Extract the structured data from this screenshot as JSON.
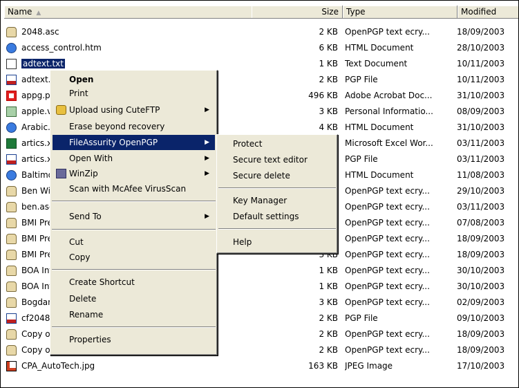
{
  "columns": {
    "name": "Name",
    "size": "Size",
    "type": "Type",
    "modified": "Modified"
  },
  "files": [
    {
      "icon": "asc",
      "name": "2048.asc",
      "size": "2 KB",
      "type": "OpenPGP text ecry...",
      "modified": "18/09/2003"
    },
    {
      "icon": "htm",
      "name": "access_control.htm",
      "size": "6 KB",
      "type": "HTML Document",
      "modified": "28/10/2003"
    },
    {
      "icon": "txt",
      "name": "adtext.txt",
      "size": "1 KB",
      "type": "Text Document",
      "modified": "10/11/2003",
      "selected": true
    },
    {
      "icon": "pgp",
      "name": "adtext.txt.pgp",
      "size": "2 KB",
      "type": "PGP File",
      "modified": "10/11/2003"
    },
    {
      "icon": "pdf",
      "name": "appg.pdf",
      "size": "496 KB",
      "type": "Adobe Acrobat Doc...",
      "modified": "31/10/2003"
    },
    {
      "icon": "vcf",
      "name": "apple.vcf",
      "size": "3 KB",
      "type": "Personal Informatio...",
      "modified": "08/09/2003"
    },
    {
      "icon": "htm",
      "name": "Arabic.htm",
      "size": "4 KB",
      "type": "HTML Document",
      "modified": "31/10/2003"
    },
    {
      "icon": "xls",
      "name": "artics.xls",
      "size": "",
      "type": "Microsoft Excel Wor...",
      "modified": "03/11/2003"
    },
    {
      "icon": "pgp",
      "name": "artics.xls.pgp",
      "size": "",
      "type": "PGP File",
      "modified": "03/11/2003"
    },
    {
      "icon": "htm",
      "name": "Baltimore.htm",
      "size": "",
      "type": "HTML Document",
      "modified": "11/08/2003"
    },
    {
      "icon": "asc",
      "name": "Ben Wilson.asc",
      "size": "",
      "type": "OpenPGP text ecry...",
      "modified": "29/10/2003"
    },
    {
      "icon": "asc",
      "name": "ben.asc",
      "size": "",
      "type": "OpenPGP text ecry...",
      "modified": "03/11/2003"
    },
    {
      "icon": "asc",
      "name": "BMI President_1.asc",
      "size": "",
      "type": "OpenPGP text ecry...",
      "modified": "07/08/2003"
    },
    {
      "icon": "asc",
      "name": "BMI President_2.asc",
      "size": "",
      "type": "OpenPGP text ecry...",
      "modified": "18/09/2003"
    },
    {
      "icon": "asc",
      "name": "BMI President_3.asc",
      "size": "3 KB",
      "type": "OpenPGP text ecry...",
      "modified": "18/09/2003"
    },
    {
      "icon": "asc",
      "name": "BOA Information.asc",
      "size": "1 KB",
      "type": "OpenPGP text ecry...",
      "modified": "30/10/2003"
    },
    {
      "icon": "asc",
      "name": "BOA Information_2.asc",
      "size": "1 KB",
      "type": "OpenPGP text ecry...",
      "modified": "30/10/2003"
    },
    {
      "icon": "asc",
      "name": "Bogdan.asc",
      "size": "3 KB",
      "type": "OpenPGP text ecry...",
      "modified": "02/09/2003"
    },
    {
      "icon": "pgp",
      "name": "cf2048.pgp",
      "size": "2 KB",
      "type": "PGP File",
      "modified": "09/10/2003"
    },
    {
      "icon": "asc",
      "name": "Copy of 2048.asc",
      "size": "2 KB",
      "type": "OpenPGP text ecry...",
      "modified": "18/09/2003"
    },
    {
      "icon": "asc",
      "name": "Copy of BMI President_3.asc",
      "size": "2 KB",
      "type": "OpenPGP text ecry...",
      "modified": "18/09/2003"
    },
    {
      "icon": "jpg",
      "name": "CPA_AutoTech.jpg",
      "size": "163 KB",
      "type": "JPEG Image",
      "modified": "17/10/2003"
    }
  ],
  "context_menu": {
    "open": "Open",
    "print": "Print",
    "upload": "Upload using CuteFTP",
    "erase": "Erase beyond recovery",
    "fileassurity": "FileAssurity OpenPGP",
    "open_with": "Open With",
    "winzip": "WinZip",
    "scan": "Scan with McAfee VirusScan",
    "send_to": "Send To",
    "cut": "Cut",
    "copy": "Copy",
    "create_shortcut": "Create Shortcut",
    "delete": "Delete",
    "rename": "Rename",
    "properties": "Properties"
  },
  "submenu": {
    "protect": "Protect",
    "secure_text_editor": "Secure text editor",
    "secure_delete": "Secure delete",
    "key_manager": "Key Manager",
    "default_settings": "Default settings",
    "help": "Help"
  },
  "colors": {
    "highlight": "#0a246a",
    "menu_bg": "#ece9d8"
  }
}
